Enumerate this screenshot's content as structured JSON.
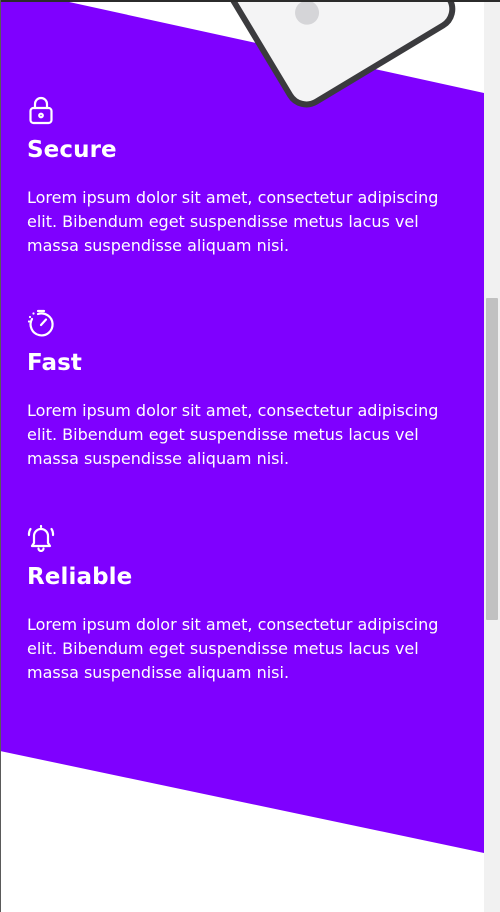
{
  "features": [
    {
      "icon": "lock-icon",
      "title": "Secure",
      "text": "Lorem ipsum dolor sit amet, consectetur adipiscing elit. Bibendum eget suspendisse metus lacus vel massa suspendisse aliquam nisi."
    },
    {
      "icon": "stopwatch-icon",
      "title": "Fast",
      "text": "Lorem ipsum dolor sit amet, consectetur adipiscing elit. Bibendum eget suspendisse metus lacus vel massa suspendisse aliquam nisi."
    },
    {
      "icon": "bell-ringing-icon",
      "title": "Reliable",
      "text": "Lorem ipsum dolor sit amet, consectetur adipiscing elit. Bibendum eget suspendisse metus lacus vel massa suspendisse aliquam nisi."
    }
  ],
  "colors": {
    "band": "#7f00ff",
    "text": "#ffffff",
    "background": "#ffffff"
  }
}
